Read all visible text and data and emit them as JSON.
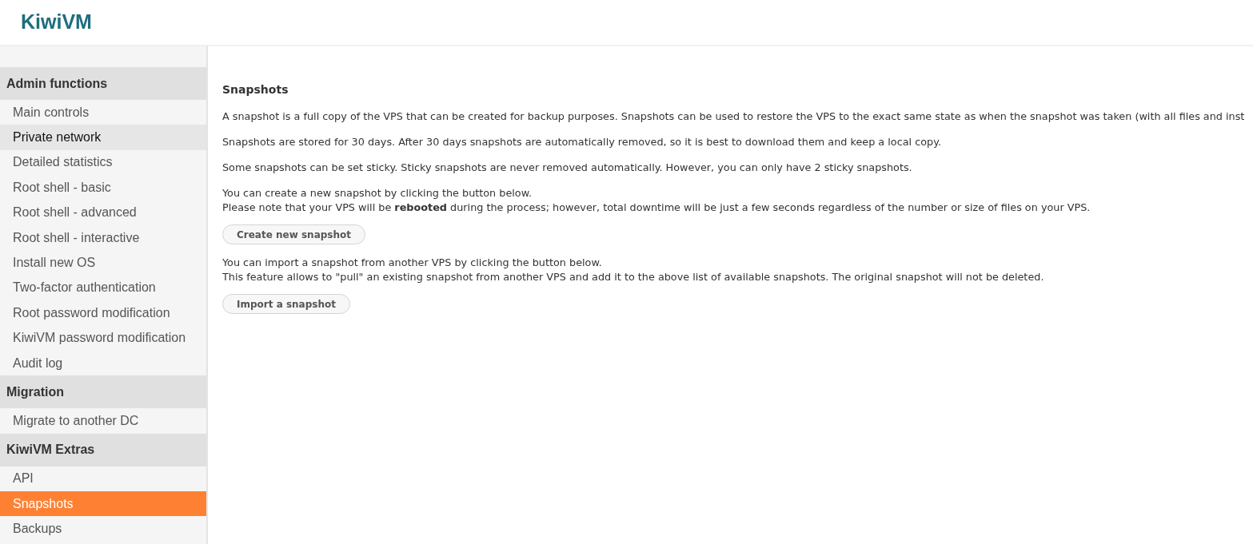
{
  "header": {
    "logo": "KiwiVM"
  },
  "sidebar": {
    "sections": [
      {
        "title": "Admin functions",
        "items": [
          {
            "label": "Main controls",
            "selected": false,
            "hovered": false
          },
          {
            "label": "Private network",
            "selected": false,
            "hovered": true
          },
          {
            "label": "Detailed statistics",
            "selected": false,
            "hovered": false
          },
          {
            "label": "Root shell - basic",
            "selected": false,
            "hovered": false
          },
          {
            "label": "Root shell - advanced",
            "selected": false,
            "hovered": false
          },
          {
            "label": "Root shell - interactive",
            "selected": false,
            "hovered": false
          },
          {
            "label": "Install new OS",
            "selected": false,
            "hovered": false
          },
          {
            "label": "Two-factor authentication",
            "selected": false,
            "hovered": false
          },
          {
            "label": "Root password modification",
            "selected": false,
            "hovered": false
          },
          {
            "label": "KiwiVM password modification",
            "selected": false,
            "hovered": false
          },
          {
            "label": "Audit log",
            "selected": false,
            "hovered": false
          }
        ]
      },
      {
        "title": "Migration",
        "items": [
          {
            "label": "Migrate to another DC",
            "selected": false,
            "hovered": false
          }
        ]
      },
      {
        "title": "KiwiVM Extras",
        "items": [
          {
            "label": "API",
            "selected": false,
            "hovered": false
          },
          {
            "label": "Snapshots",
            "selected": true,
            "hovered": false
          },
          {
            "label": "Backups",
            "selected": false,
            "hovered": false
          }
        ]
      }
    ]
  },
  "content": {
    "title": "Snapshots",
    "blocks": [
      {
        "kind": "paragraph",
        "lines": [
          "A snapshot is a full copy of the VPS that can be created for backup purposes. Snapshots can be used to restore the VPS to the exact same state as when the snapshot was taken (with all files and inst"
        ]
      },
      {
        "kind": "paragraph",
        "lines": [
          "Snapshots are stored for 30 days. After 30 days snapshots are automatically removed, so it is best to download them and keep a local copy."
        ]
      },
      {
        "kind": "paragraph",
        "lines": [
          "Some snapshots can be set sticky. Sticky snapshots are never removed automatically. However, you can only have 2 sticky snapshots."
        ]
      },
      {
        "kind": "paragraph",
        "lines": [
          "You can create a new snapshot by clicking the button below.",
          "Please note that your VPS will be **rebooted** during the process; however, total downtime will be just a few seconds regardless of the number or size of files on your VPS."
        ]
      },
      {
        "kind": "button",
        "label": "Create new snapshot"
      },
      {
        "kind": "paragraph",
        "lines": [
          "You can import a snapshot from another VPS by clicking the button below.",
          "This feature allows to \"pull\" an existing snapshot from another VPS and add it to the above list of available snapshots. The original snapshot will not be deleted."
        ]
      },
      {
        "kind": "button",
        "label": "Import a snapshot"
      }
    ]
  }
}
